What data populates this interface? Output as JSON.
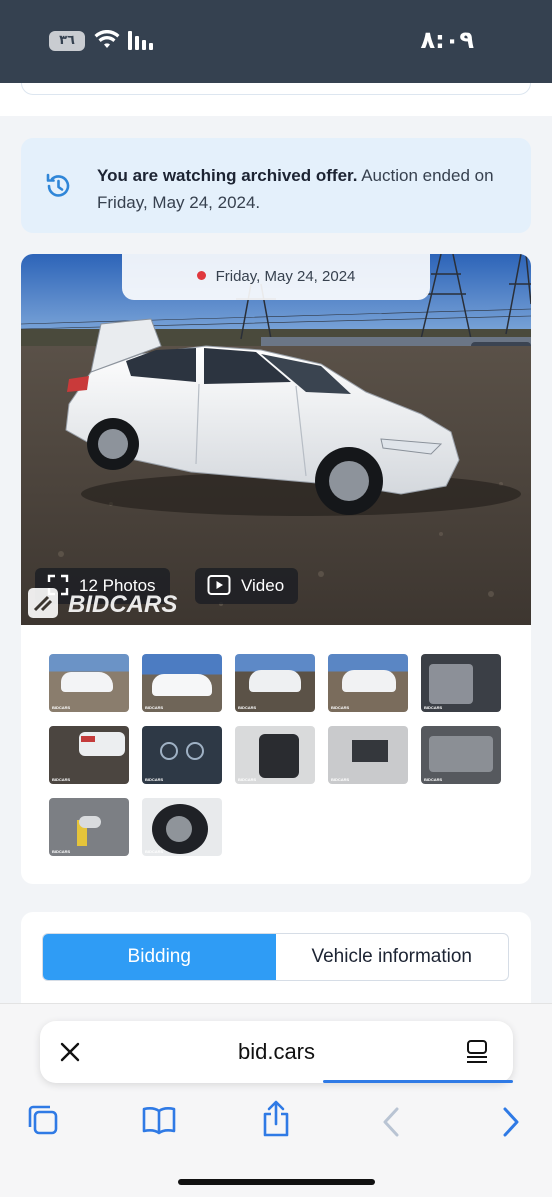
{
  "status_bar": {
    "time": "٨:٠٩",
    "battery": "٣٦"
  },
  "notice": {
    "bold": "You are watching archived offer.",
    "text": " Auction ended on Friday, May 24, 2024."
  },
  "gallery": {
    "date": "Friday, May 24, 2024",
    "photos_label": "12 Photos",
    "video_label": "Video",
    "watermark": "BIDCARS",
    "thumbnails": [
      {
        "label": "BIDCARS"
      },
      {
        "label": "BIDCARS"
      },
      {
        "label": "BIDCARS"
      },
      {
        "label": "BIDCARS"
      },
      {
        "label": "BIDCARS"
      },
      {
        "label": "BIDCARS"
      },
      {
        "label": "BIDCARS"
      },
      {
        "label": "BIDCARS"
      },
      {
        "label": "BIDCARS"
      },
      {
        "label": "BIDCARS"
      },
      {
        "label": "BIDCARS"
      },
      {
        "label": "BIDCARS"
      }
    ]
  },
  "tabs": [
    {
      "label": "Bidding",
      "active": true
    },
    {
      "label": "Vehicle information",
      "active": false
    }
  ],
  "browser": {
    "url": "bid.cars",
    "accent": "#2f7ae5"
  },
  "colors": {
    "status_bar": "#354150",
    "notice_bg": "#e4f0fb",
    "active_tab": "#2f9cf5"
  },
  "icons": [
    "close-icon",
    "reader-icon",
    "tabs-icon",
    "bookmarks-icon",
    "share-icon",
    "back-icon",
    "forward-icon",
    "history-icon",
    "expand-icon",
    "play-icon",
    "wifi-icon",
    "signal-icon"
  ]
}
